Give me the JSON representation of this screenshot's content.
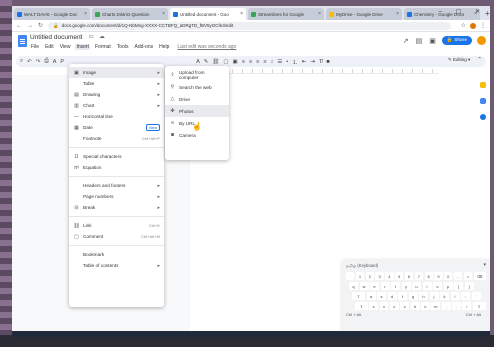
{
  "browser": {
    "tabs": [
      {
        "label": "WALT DAHS - Google Doc",
        "color": "#1a73e8",
        "active": false
      },
      {
        "label": "Charts District Question",
        "color": "#34a853",
        "active": false
      },
      {
        "label": "Untitled document - Goo",
        "color": "#1a73e8",
        "active": true
      },
      {
        "label": "Streamlines for Google",
        "color": "#34a853",
        "active": false
      },
      {
        "label": "MyDrive - Google Drive",
        "color": "#fbbc04",
        "active": false
      },
      {
        "label": "Chemistry - Google Docs",
        "color": "#1a73e8",
        "active": false
      }
    ],
    "url": "docs.google.com/document/d/1Q-NbMng-XXXX-CCTBFQ_aDRgTD_fBV5yOCfe3/edit"
  },
  "doc": {
    "title": "Untitled document",
    "menus": [
      "File",
      "Edit",
      "View",
      "Insert",
      "Format",
      "Tools",
      "Add-ons",
      "Help"
    ],
    "open_menu": "Insert",
    "last_edit": "Last edit was seconds ago",
    "share_label": "Share",
    "editing_label": "Editing"
  },
  "insert_menu": {
    "items": [
      {
        "icon": "image-icon",
        "glyph": "▣",
        "label": "Image",
        "arrow": "▸",
        "highlight": true
      },
      {
        "icon": "",
        "glyph": "",
        "label": "Table",
        "arrow": "▸"
      },
      {
        "icon": "drawing-icon",
        "glyph": "▤",
        "label": "Drawing",
        "arrow": "▸"
      },
      {
        "icon": "chart-icon",
        "glyph": "▥",
        "label": "Chart",
        "arrow": "▸"
      },
      {
        "icon": "horizontal-line-icon",
        "glyph": "—",
        "label": "Horizontal line"
      },
      {
        "icon": "date-icon",
        "glyph": "▦",
        "label": "Date",
        "badge": "New"
      },
      {
        "icon": "",
        "glyph": "",
        "label": "Footnote",
        "hint": "Ctrl+Alt+F"
      },
      {
        "sep": true
      },
      {
        "icon": "special-characters-icon",
        "glyph": "Ω",
        "label": "Special characters"
      },
      {
        "icon": "equation-icon",
        "glyph": "π²",
        "label": "Equation"
      },
      {
        "sep": true
      },
      {
        "icon": "",
        "glyph": "",
        "label": "Headers and footers",
        "arrow": "▸"
      },
      {
        "icon": "",
        "glyph": "",
        "label": "Page numbers",
        "arrow": "▸"
      },
      {
        "icon": "break-icon",
        "glyph": "⊟",
        "label": "Break",
        "arrow": "▸"
      },
      {
        "sep": true
      },
      {
        "icon": "link-icon",
        "glyph": "⛓",
        "label": "Link",
        "hint": "Ctrl+K"
      },
      {
        "icon": "comment-icon",
        "glyph": "▢",
        "label": "Comment",
        "hint": "Ctrl+Alt+M"
      },
      {
        "sep": true
      },
      {
        "icon": "",
        "glyph": "",
        "label": "Bookmark"
      },
      {
        "icon": "",
        "glyph": "",
        "label": "Table of contents",
        "arrow": "▸"
      }
    ]
  },
  "image_submenu": {
    "items": [
      {
        "icon": "upload-icon",
        "glyph": "⇪",
        "label": "Upload from computer"
      },
      {
        "icon": "search-web-icon",
        "glyph": "⚲",
        "label": "Search the web"
      },
      {
        "icon": "drive-icon",
        "glyph": "△",
        "label": "Drive"
      },
      {
        "icon": "photos-icon",
        "glyph": "✤",
        "label": "Photos"
      },
      {
        "icon": "by-url-icon",
        "glyph": "∞",
        "label": "By URL"
      },
      {
        "icon": "camera-icon",
        "glyph": "◙",
        "label": "Camera"
      }
    ]
  },
  "keyboard": {
    "title": "தமிழ் (Keyboard)",
    "rows": [
      [
        "`",
        "1",
        "2",
        "3",
        "4",
        "5",
        "6",
        "7",
        "8",
        "9",
        "0",
        "-",
        "=",
        "⌫"
      ],
      [
        "q",
        "w",
        "e",
        "r",
        "t",
        "y",
        "u",
        "i",
        "o",
        "p",
        "[",
        "]"
      ],
      [
        "⇪",
        "a",
        "s",
        "d",
        "f",
        "g",
        "h",
        "j",
        "k",
        "l",
        ";",
        "'"
      ],
      [
        "⇧",
        "z",
        "x",
        "c",
        "v",
        "b",
        "n",
        "m",
        ",",
        ".",
        "/",
        "⇧"
      ]
    ],
    "footer_left": "Ctrl + Alt",
    "footer_right": "Ctrl + Alt"
  }
}
